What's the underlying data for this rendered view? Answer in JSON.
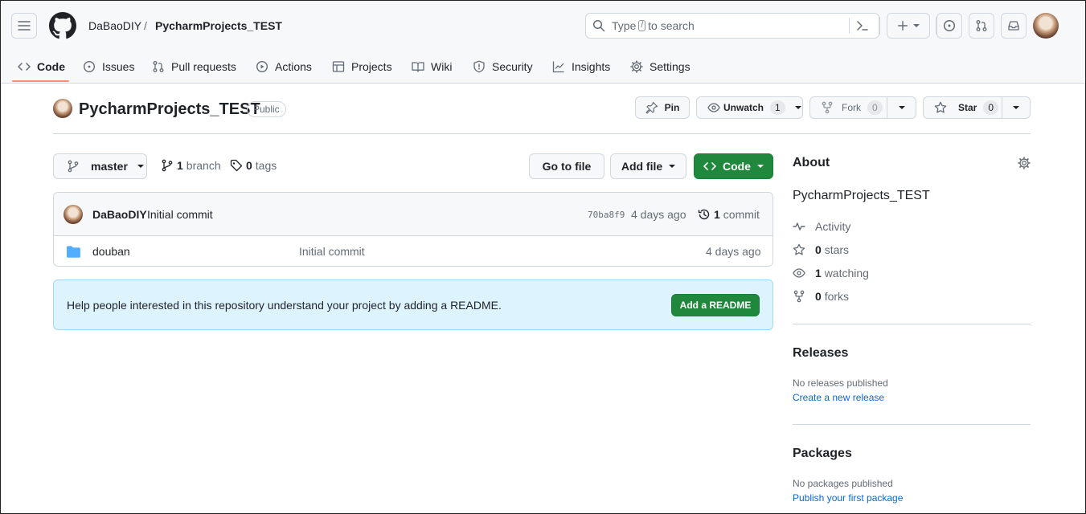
{
  "header": {
    "owner": "DaBaoDIY",
    "separator": "/",
    "repo": "PycharmProjects_TEST",
    "search": {
      "prefix": "Type",
      "key": "/",
      "suffix": "to search"
    },
    "plus_label": "+"
  },
  "tabs": [
    {
      "label": "Code",
      "icon": "code-icon",
      "active": true
    },
    {
      "label": "Issues",
      "icon": "issue-opened-icon"
    },
    {
      "label": "Pull requests",
      "icon": "git-pull-request-icon"
    },
    {
      "label": "Actions",
      "icon": "play-icon"
    },
    {
      "label": "Projects",
      "icon": "table-icon"
    },
    {
      "label": "Wiki",
      "icon": "book-icon"
    },
    {
      "label": "Security",
      "icon": "shield-icon"
    },
    {
      "label": "Insights",
      "icon": "graph-icon"
    },
    {
      "label": "Settings",
      "icon": "gear-icon"
    }
  ],
  "repo_header": {
    "name": "PycharmProjects_TEST",
    "visibility": "Public",
    "pin_label": "Pin",
    "unwatch_label": "Unwatch",
    "watch_count": "1",
    "fork_label": "Fork",
    "fork_count": "0",
    "star_label": "Star",
    "star_count": "0"
  },
  "toolbar": {
    "branch": "master",
    "branches_count": "1",
    "branches_label": "branch",
    "tags_count": "0",
    "tags_label": "tags",
    "go_to_file": "Go to file",
    "add_file": "Add file",
    "code": "Code"
  },
  "latest_commit": {
    "author": "DaBaoDIY",
    "message": "Initial commit",
    "sha": "70ba8f9",
    "time": "4 days ago",
    "commits_count": "1",
    "commits_label": "commit"
  },
  "files": [
    {
      "name": "douban",
      "type": "folder",
      "message": "Initial commit",
      "time": "4 days ago"
    }
  ],
  "readme_prompt": {
    "text": "Help people interested in this repository understand your project by adding a README.",
    "button": "Add a README"
  },
  "about": {
    "title": "About",
    "description": "PycharmProjects_TEST",
    "activity": "Activity",
    "stars_count": "0",
    "stars_label": "stars",
    "watching_count": "1",
    "watching_label": "watching",
    "forks_count": "0",
    "forks_label": "forks"
  },
  "releases": {
    "title": "Releases",
    "empty": "No releases published",
    "link": "Create a new release"
  },
  "packages": {
    "title": "Packages",
    "empty": "No packages published",
    "link": "Publish your first package"
  },
  "colors": {
    "accent_green": "#1f883d",
    "link_blue": "#0969da",
    "tab_underline": "#fd8c73",
    "readme_bg": "#ddf4ff"
  }
}
